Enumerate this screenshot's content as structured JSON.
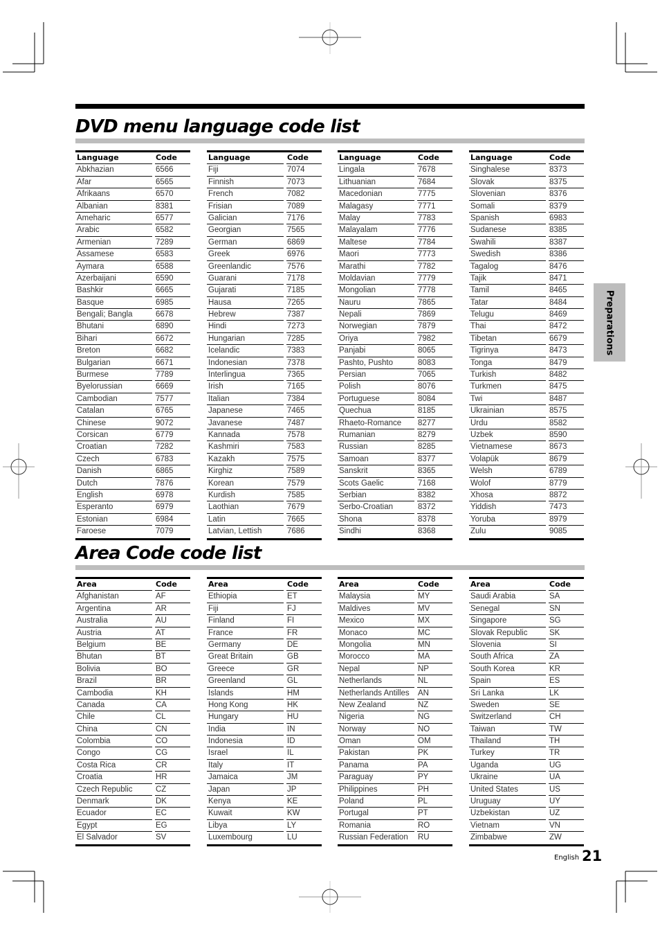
{
  "section_tab": "Preparations",
  "footer": {
    "language": "English",
    "page_number": "21"
  },
  "language_section": {
    "title": "DVD menu language code list",
    "headers": {
      "name": "Language",
      "code": "Code"
    },
    "columns": [
      [
        [
          "Abkhazian",
          "6566"
        ],
        [
          "Afar",
          "6565"
        ],
        [
          "Afrikaans",
          "6570"
        ],
        [
          "Albanian",
          "8381"
        ],
        [
          "Ameharic",
          "6577"
        ],
        [
          "Arabic",
          "6582"
        ],
        [
          "Armenian",
          "7289"
        ],
        [
          "Assamese",
          "6583"
        ],
        [
          "Aymara",
          "6588"
        ],
        [
          "Azerbaijani",
          "6590"
        ],
        [
          "Bashkir",
          "6665"
        ],
        [
          "Basque",
          "6985"
        ],
        [
          "Bengali; Bangla",
          "6678"
        ],
        [
          "Bhutani",
          "6890"
        ],
        [
          "Bihari",
          "6672"
        ],
        [
          "Breton",
          "6682"
        ],
        [
          "Bulgarian",
          "6671"
        ],
        [
          "Burmese",
          "7789"
        ],
        [
          "Byelorussian",
          "6669"
        ],
        [
          "Cambodian",
          "7577"
        ],
        [
          "Catalan",
          "6765"
        ],
        [
          "Chinese",
          "9072"
        ],
        [
          "Corsican",
          "6779"
        ],
        [
          "Croatian",
          "7282"
        ],
        [
          "Czech",
          "6783"
        ],
        [
          "Danish",
          "6865"
        ],
        [
          "Dutch",
          "7876"
        ],
        [
          "English",
          "6978"
        ],
        [
          "Esperanto",
          "6979"
        ],
        [
          "Estonian",
          "6984"
        ],
        [
          "Faroese",
          "7079"
        ]
      ],
      [
        [
          "Fiji",
          "7074"
        ],
        [
          "Finnish",
          "7073"
        ],
        [
          "French",
          "7082"
        ],
        [
          "Frisian",
          "7089"
        ],
        [
          "Galician",
          "7176"
        ],
        [
          "Georgian",
          "7565"
        ],
        [
          "German",
          "6869"
        ],
        [
          "Greek",
          "6976"
        ],
        [
          "Greenlandic",
          "7576"
        ],
        [
          "Guarani",
          "7178"
        ],
        [
          "Gujarati",
          "7185"
        ],
        [
          "Hausa",
          "7265"
        ],
        [
          "Hebrew",
          "7387"
        ],
        [
          "Hindi",
          "7273"
        ],
        [
          "Hungarian",
          "7285"
        ],
        [
          "Icelandic",
          "7383"
        ],
        [
          "Indonesian",
          "7378"
        ],
        [
          "Interlingua",
          "7365"
        ],
        [
          "Irish",
          "7165"
        ],
        [
          "Italian",
          "7384"
        ],
        [
          "Japanese",
          "7465"
        ],
        [
          "Javanese",
          "7487"
        ],
        [
          "Kannada",
          "7578"
        ],
        [
          "Kashmiri",
          "7583"
        ],
        [
          "Kazakh",
          "7575"
        ],
        [
          "Kirghiz",
          "7589"
        ],
        [
          "Korean",
          "7579"
        ],
        [
          "Kurdish",
          "7585"
        ],
        [
          "Laothian",
          "7679"
        ],
        [
          "Latin",
          "7665"
        ],
        [
          "Latvian, Lettish",
          "7686"
        ]
      ],
      [
        [
          "Lingala",
          "7678"
        ],
        [
          "Lithuanian",
          "7684"
        ],
        [
          "Macedonian",
          "7775"
        ],
        [
          "Malagasy",
          "7771"
        ],
        [
          "Malay",
          "7783"
        ],
        [
          "Malayalam",
          "7776"
        ],
        [
          "Maltese",
          "7784"
        ],
        [
          "Maori",
          "7773"
        ],
        [
          "Marathi",
          "7782"
        ],
        [
          "Moldavian",
          "7779"
        ],
        [
          "Mongolian",
          "7778"
        ],
        [
          "Nauru",
          "7865"
        ],
        [
          "Nepali",
          "7869"
        ],
        [
          "Norwegian",
          "7879"
        ],
        [
          "Oriya",
          "7982"
        ],
        [
          "Panjabi",
          "8065"
        ],
        [
          "Pashto, Pushto",
          "8083"
        ],
        [
          "Persian",
          "7065"
        ],
        [
          "Polish",
          "8076"
        ],
        [
          "Portuguese",
          "8084"
        ],
        [
          "Quechua",
          "8185"
        ],
        [
          "Rhaeto-Romance",
          "8277"
        ],
        [
          "Rumanian",
          "8279"
        ],
        [
          "Russian",
          "8285"
        ],
        [
          "Samoan",
          "8377"
        ],
        [
          "Sanskrit",
          "8365"
        ],
        [
          "Scots Gaelic",
          "7168"
        ],
        [
          "Serbian",
          "8382"
        ],
        [
          "Serbo-Croatian",
          "8372"
        ],
        [
          "Shona",
          "8378"
        ],
        [
          "Sindhi",
          "8368"
        ]
      ],
      [
        [
          "Singhalese",
          "8373"
        ],
        [
          "Slovak",
          "8375"
        ],
        [
          "Slovenian",
          "8376"
        ],
        [
          "Somali",
          "8379"
        ],
        [
          "Spanish",
          "6983"
        ],
        [
          "Sudanese",
          "8385"
        ],
        [
          "Swahili",
          "8387"
        ],
        [
          "Swedish",
          "8386"
        ],
        [
          "Tagalog",
          "8476"
        ],
        [
          "Tajik",
          "8471"
        ],
        [
          "Tamil",
          "8465"
        ],
        [
          "Tatar",
          "8484"
        ],
        [
          "Telugu",
          "8469"
        ],
        [
          "Thai",
          "8472"
        ],
        [
          "Tibetan",
          "6679"
        ],
        [
          "Tigrinya",
          "8473"
        ],
        [
          "Tonga",
          "8479"
        ],
        [
          "Turkish",
          "8482"
        ],
        [
          "Turkmen",
          "8475"
        ],
        [
          "Twi",
          "8487"
        ],
        [
          "Ukrainian",
          "8575"
        ],
        [
          "Urdu",
          "8582"
        ],
        [
          "Uzbek",
          "8590"
        ],
        [
          "Vietnamese",
          "8673"
        ],
        [
          "Volapük",
          "8679"
        ],
        [
          "Welsh",
          "6789"
        ],
        [
          "Wolof",
          "8779"
        ],
        [
          "Xhosa",
          "8872"
        ],
        [
          "Yiddish",
          "7473"
        ],
        [
          "Yoruba",
          "8979"
        ],
        [
          "Zulu",
          "9085"
        ]
      ]
    ]
  },
  "area_section": {
    "title": "Area Code code list",
    "headers": {
      "name": "Area",
      "code": "Code"
    },
    "columns": [
      [
        [
          "Afghanistan",
          "AF"
        ],
        [
          "Argentina",
          "AR"
        ],
        [
          "Australia",
          "AU"
        ],
        [
          "Austria",
          "AT"
        ],
        [
          "Belgium",
          "BE"
        ],
        [
          "Bhutan",
          "BT"
        ],
        [
          "Bolivia",
          "BO"
        ],
        [
          "Brazil",
          "BR"
        ],
        [
          "Cambodia",
          "KH"
        ],
        [
          "Canada",
          "CA"
        ],
        [
          "Chile",
          "CL"
        ],
        [
          "China",
          "CN"
        ],
        [
          "Colombia",
          "CO"
        ],
        [
          "Congo",
          "CG"
        ],
        [
          "Costa Rica",
          "CR"
        ],
        [
          "Croatia",
          "HR"
        ],
        [
          "Czech Republic",
          "CZ"
        ],
        [
          "Denmark",
          "DK"
        ],
        [
          "Ecuador",
          "EC"
        ],
        [
          "Egypt",
          "EG"
        ],
        [
          "El Salvador",
          "SV"
        ]
      ],
      [
        [
          "Ethiopia",
          "ET"
        ],
        [
          "Fiji",
          "FJ"
        ],
        [
          "Finland",
          "FI"
        ],
        [
          "France",
          "FR"
        ],
        [
          "Germany",
          "DE"
        ],
        [
          "Great Britain",
          "GB"
        ],
        [
          "Greece",
          "GR"
        ],
        [
          "Greenland",
          "GL"
        ],
        [
          "Islands",
          "HM"
        ],
        [
          "Hong Kong",
          "HK"
        ],
        [
          "Hungary",
          "HU"
        ],
        [
          "India",
          "IN"
        ],
        [
          "Indonesia",
          "ID"
        ],
        [
          "Israel",
          "IL"
        ],
        [
          "Italy",
          "IT"
        ],
        [
          "Jamaica",
          "JM"
        ],
        [
          "Japan",
          "JP"
        ],
        [
          "Kenya",
          "KE"
        ],
        [
          "Kuwait",
          "KW"
        ],
        [
          "Libya",
          "LY"
        ],
        [
          "Luxembourg",
          "LU"
        ]
      ],
      [
        [
          "Malaysia",
          "MY"
        ],
        [
          "Maldives",
          "MV"
        ],
        [
          "Mexico",
          "MX"
        ],
        [
          "Monaco",
          "MC"
        ],
        [
          "Mongolia",
          "MN"
        ],
        [
          "Morocco",
          "MA"
        ],
        [
          "Nepal",
          "NP"
        ],
        [
          "Netherlands",
          "NL"
        ],
        [
          "Netherlands Antilles",
          "AN"
        ],
        [
          "New Zealand",
          "NZ"
        ],
        [
          "Nigeria",
          "NG"
        ],
        [
          "Norway",
          "NO"
        ],
        [
          "Oman",
          "OM"
        ],
        [
          "Pakistan",
          "PK"
        ],
        [
          "Panama",
          "PA"
        ],
        [
          "Paraguay",
          "PY"
        ],
        [
          "Philippines",
          "PH"
        ],
        [
          "Poland",
          "PL"
        ],
        [
          "Portugal",
          "PT"
        ],
        [
          "Romania",
          "RO"
        ],
        [
          "Russian Federation",
          "RU"
        ]
      ],
      [
        [
          "Saudi Arabia",
          "SA"
        ],
        [
          "Senegal",
          "SN"
        ],
        [
          "Singapore",
          "SG"
        ],
        [
          "Slovak Republic",
          "SK"
        ],
        [
          "Slovenia",
          "SI"
        ],
        [
          "South Africa",
          "ZA"
        ],
        [
          "South Korea",
          "KR"
        ],
        [
          "Spain",
          "ES"
        ],
        [
          "Sri Lanka",
          "LK"
        ],
        [
          "Sweden",
          "SE"
        ],
        [
          "Switzerland",
          "CH"
        ],
        [
          "Taiwan",
          "TW"
        ],
        [
          "Thailand",
          "TH"
        ],
        [
          "Turkey",
          "TR"
        ],
        [
          "Uganda",
          "UG"
        ],
        [
          "Ukraine",
          "UA"
        ],
        [
          "United States",
          "US"
        ],
        [
          "Uruguay",
          "UY"
        ],
        [
          "Uzbekistan",
          "UZ"
        ],
        [
          "Vietnam",
          "VN"
        ],
        [
          "Zimbabwe",
          "ZW"
        ]
      ]
    ]
  }
}
